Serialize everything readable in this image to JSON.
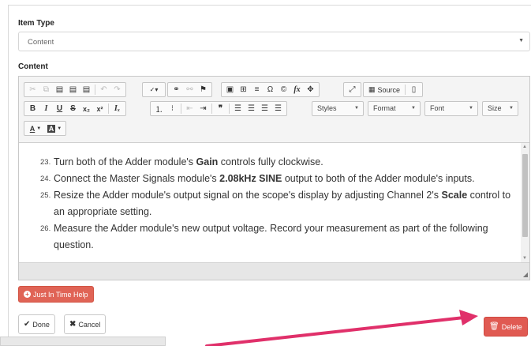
{
  "form": {
    "item_type_label": "Item Type",
    "item_type_value": "Content",
    "content_label": "Content"
  },
  "toolbar": {
    "source_label": "Source",
    "styles_label": "Styles",
    "format_label": "Format",
    "font_label": "Font",
    "size_label": "Size",
    "font_color_label": "A",
    "bg_color_label": "A"
  },
  "content": {
    "steps": [
      {
        "num": "23.",
        "pre": "Turn both of the Adder module's ",
        "bold": "Gain",
        "post": " controls fully clockwise."
      },
      {
        "num": "24.",
        "pre": "Connect the Master Signals module's ",
        "bold": "2.08kHz SINE",
        "post": " output to both of the Adder module's inputs."
      },
      {
        "num": "25.",
        "pre": "Resize the Adder module's output signal on the scope's display by adjusting Channel 2's ",
        "bold": "Scale",
        "post": " control to an appropriate setting."
      },
      {
        "num": "26.",
        "pre": "Measure the Adder module's new output voltage. Record your measurement as part of the following question.",
        "bold": "",
        "post": ""
      }
    ]
  },
  "buttons": {
    "help_label": "Just In Time Help",
    "done_label": "Done",
    "cancel_label": "Cancel",
    "delete_label": "Delete"
  },
  "colors": {
    "help_bg": "#e06456",
    "delete_bg": "#e05a52",
    "arrow": "#e0306a"
  }
}
